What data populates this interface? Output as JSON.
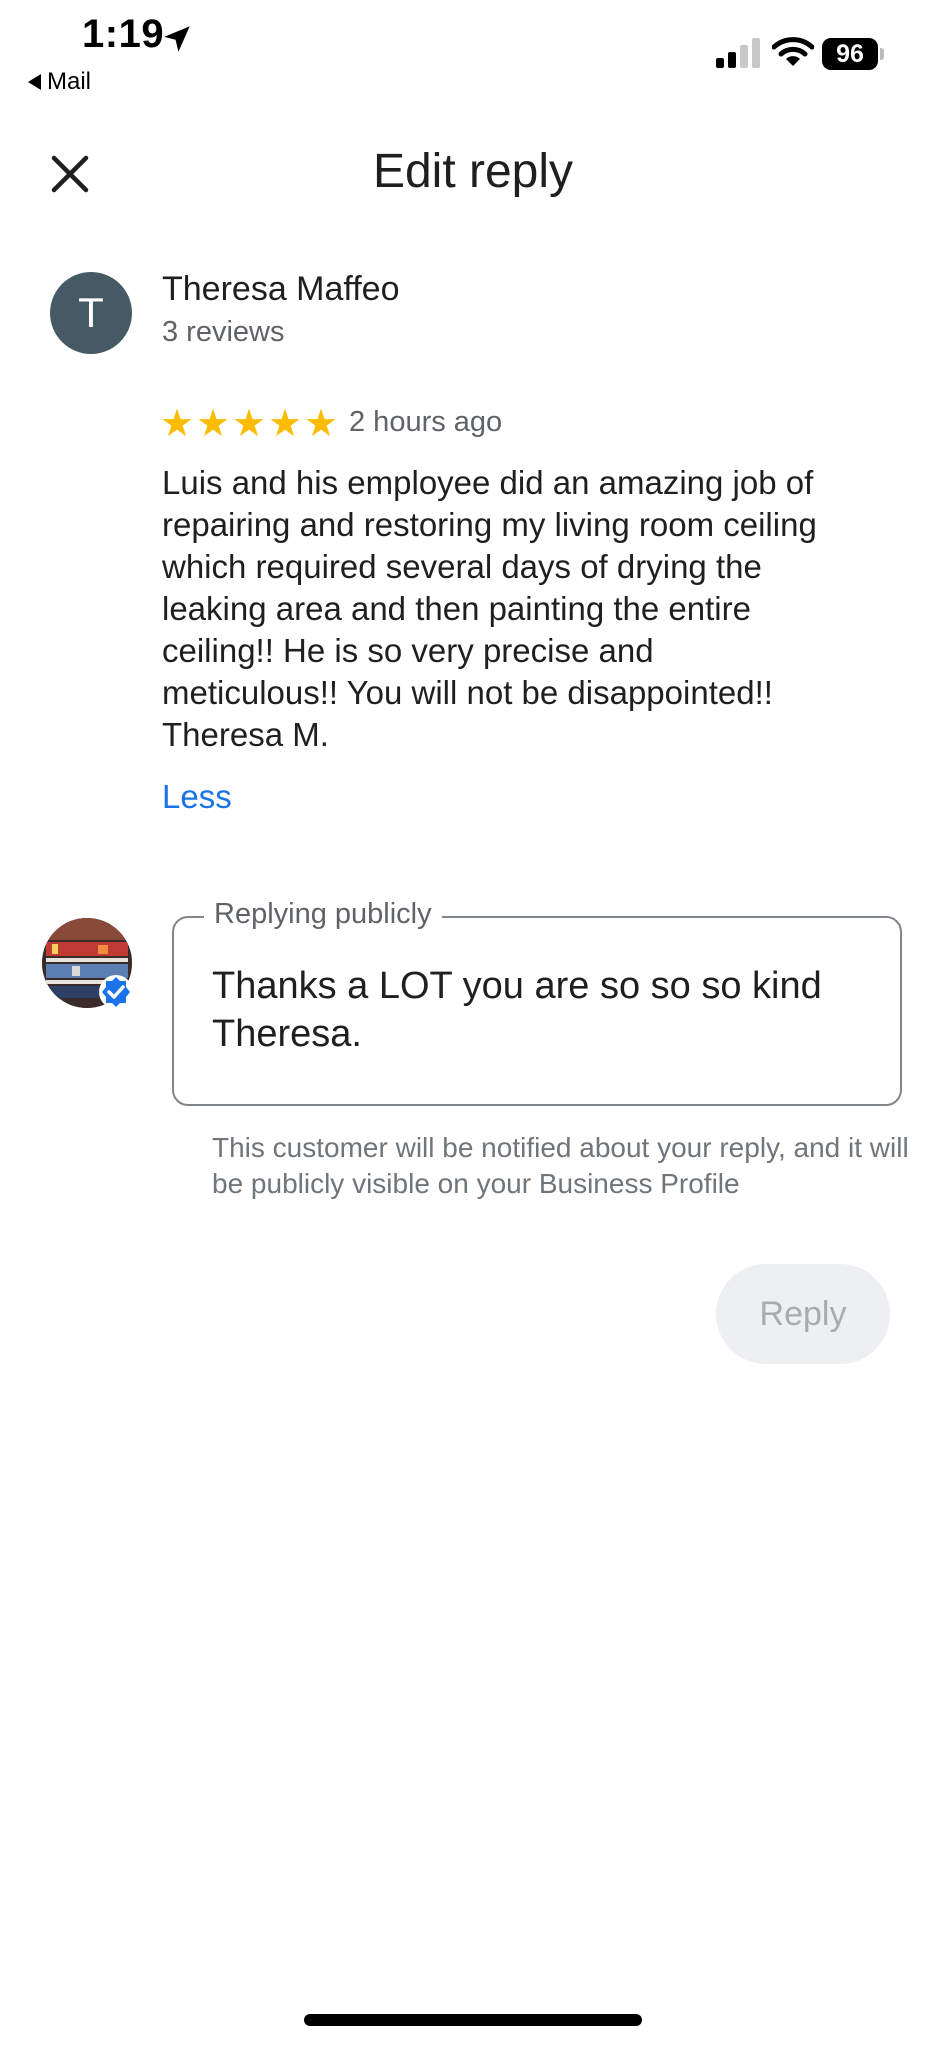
{
  "status_bar": {
    "time": "1:19",
    "back_app": "Mail",
    "battery": "96",
    "icons": [
      "location-arrow-icon",
      "signal-icon",
      "wifi-icon",
      "battery-icon"
    ]
  },
  "header": {
    "title": "Edit reply",
    "close_icon": "close-icon"
  },
  "review": {
    "avatar_letter": "T",
    "avatar_color": "#455a64",
    "reviewer_name": "Theresa Maffeo",
    "review_count": "3 reviews",
    "rating": 5,
    "time_ago": "2 hours ago",
    "text": "Luis and his employee did an amazing job of\nrepairing and restoring my living room ceiling\nwhich required several days of drying the\nleaking area and then painting the entire\nceiling!!  He is so very precise and\nmeticulous!!  You will not be disappointed!!\nTheresa M.",
    "less_label": "Less",
    "star_color": "#fbbc04"
  },
  "reply": {
    "legend": "Replying publicly",
    "value": "Thanks a LOT you are so so so kind\nTheresa.",
    "notice": "This customer will be notified about your reply, and it will be publicly visible on your Business Profile",
    "button_label": "Reply",
    "accent_color": "#1a73e8"
  }
}
